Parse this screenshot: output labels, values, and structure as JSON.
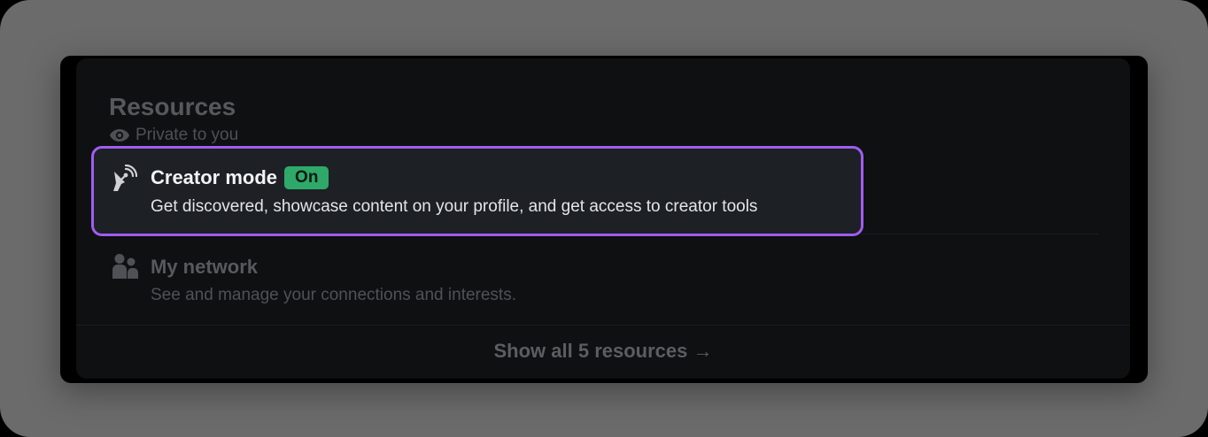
{
  "resources": {
    "title": "Resources",
    "visibility_label": "Private to you",
    "visibility_icon": "eye-icon",
    "items": [
      {
        "icon": "broadcast-antenna-icon",
        "title": "Creator mode",
        "badge": "On",
        "description": "Get discovered, showcase content on your profile, and get access to creator tools",
        "highlighted": true
      },
      {
        "icon": "people-icon",
        "title": "My network",
        "description": "See and manage your connections and interests.",
        "highlighted": false
      }
    ],
    "show_all_label": "Show all 5 resources →"
  },
  "colors": {
    "highlight_border": "#a15cf0",
    "badge_green": "#2ea96a",
    "card_background": "#0f1012"
  }
}
